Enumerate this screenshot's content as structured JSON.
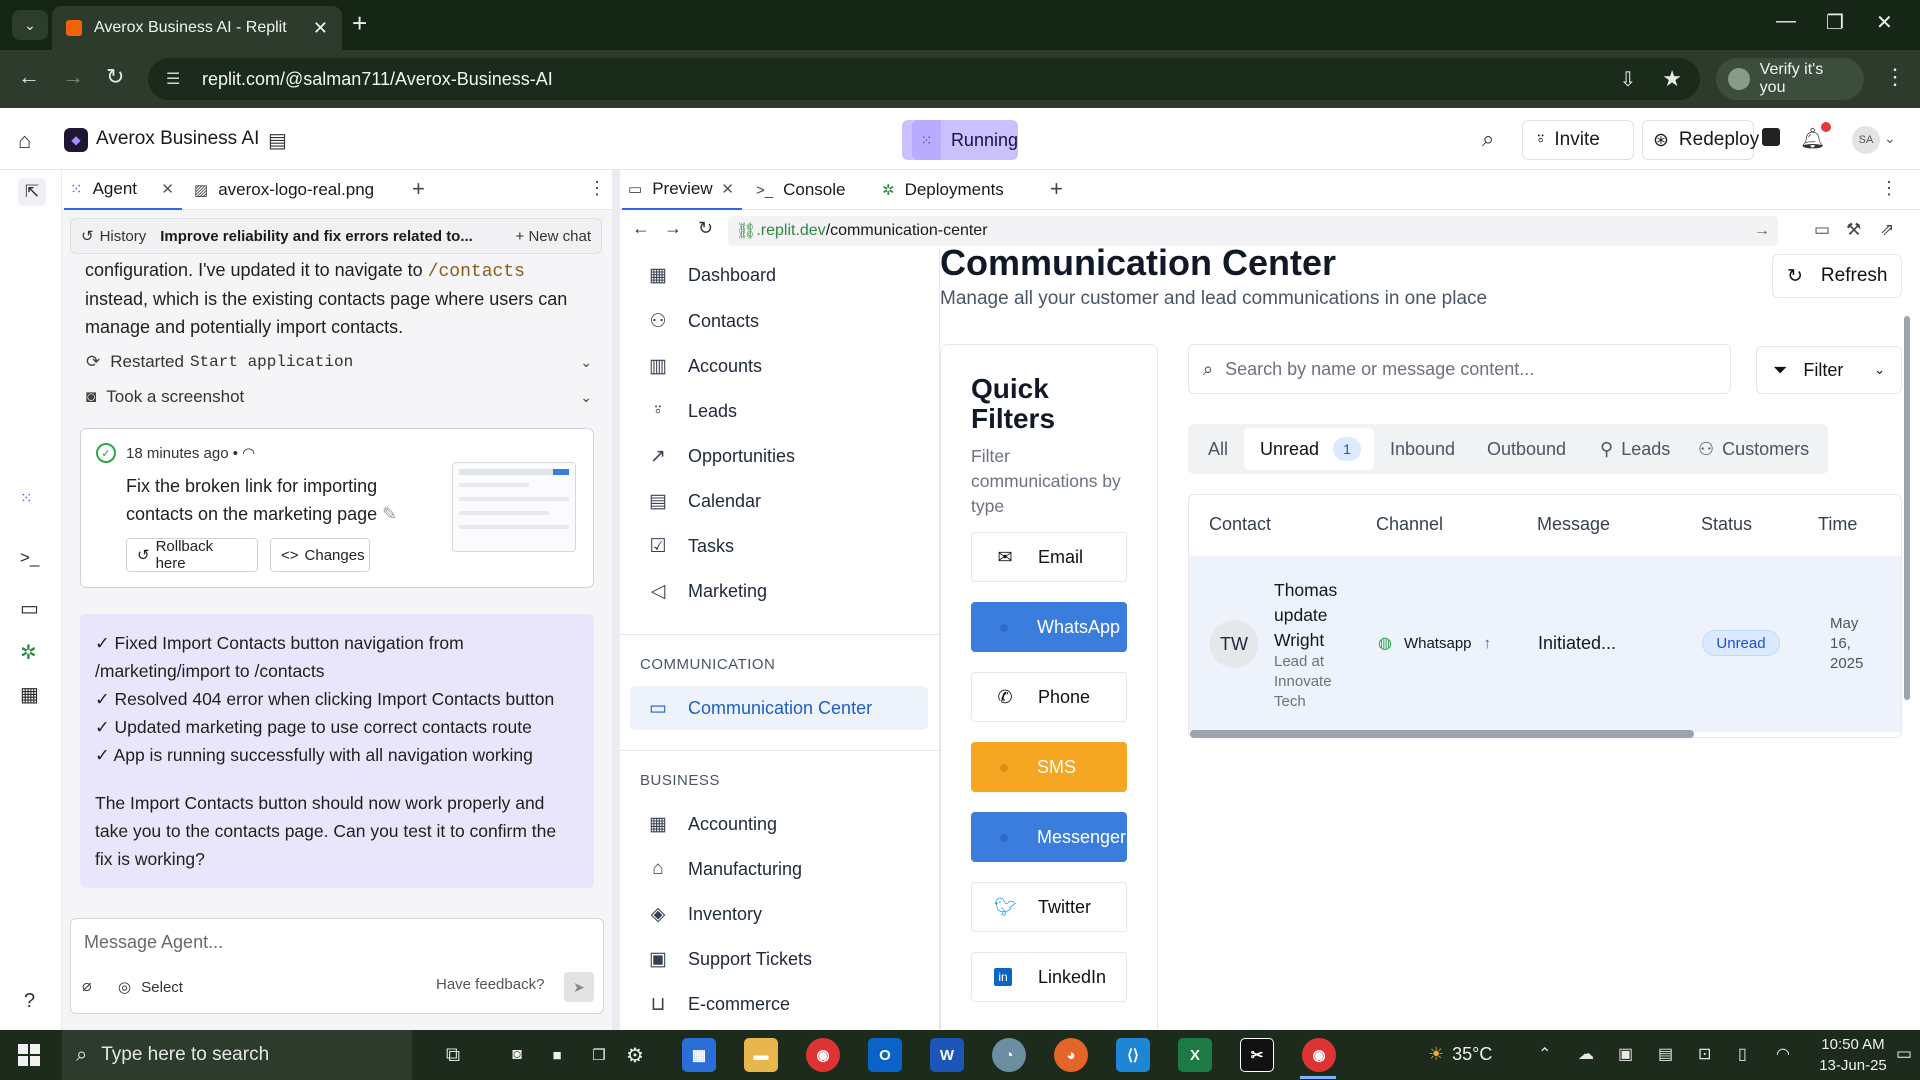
{
  "browser": {
    "tab_title": "Averox Business AI - Replit",
    "url": "replit.com/@salman711/Averox-Business-AI",
    "verify_label": "Verify it's you"
  },
  "header": {
    "app_name": "Averox Business AI",
    "status": "Running",
    "invite_label": "Invite",
    "redeploy_label": "Redeploy",
    "avatar_initials": "SA"
  },
  "agent_panel": {
    "tabs": [
      {
        "label": "Agent"
      },
      {
        "label": "averox-logo-real.png"
      }
    ],
    "history_label": "History",
    "thread_title": "Improve reliability and fix errors related to...",
    "new_chat_label": "New chat",
    "prev_text_1": "configuration. I've updated it to navigate to",
    "prev_code": "/contacts",
    "prev_text_2": "instead, which is the existing contacts page where users can",
    "prev_text_3": "manage and potentially import contacts.",
    "action_restart_label": "Restarted",
    "action_restart_code": "Start application",
    "action_screenshot": "Took a screenshot",
    "checkpoint": {
      "time": "18 minutes ago",
      "title": "Fix the broken link for importing contacts on the marketing page",
      "rollback_label": "Rollback here",
      "changes_label": "Changes"
    },
    "summary_lines": [
      "✓ Fixed Import Contacts button navigation from",
      "/marketing/import to /contacts",
      "✓ Resolved 404 error when clicking Import Contacts button",
      "✓ Updated marketing page to use correct contacts route",
      "✓ App is running successfully with all navigation working"
    ],
    "closing_lines": [
      "The Import Contacts button should now work properly and",
      "take you to the contacts page. Can you test it to confirm the",
      "fix is working?"
    ],
    "input_placeholder": "Message Agent...",
    "select_label": "Select",
    "feedback_label": "Have feedback?"
  },
  "preview_panel": {
    "tabs": [
      {
        "label": "Preview"
      },
      {
        "label": "Console"
      },
      {
        "label": "Deployments"
      }
    ],
    "url_domain": ".replit.dev",
    "url_path": "/communication-center"
  },
  "app_nav": {
    "items": [
      {
        "label": "Dashboard",
        "icon": "grid-icon"
      },
      {
        "label": "Contacts",
        "icon": "users-icon"
      },
      {
        "label": "Accounts",
        "icon": "building-icon"
      },
      {
        "label": "Leads",
        "icon": "user-plus-icon"
      },
      {
        "label": "Opportunities",
        "icon": "trending-icon"
      },
      {
        "label": "Calendar",
        "icon": "calendar-icon"
      },
      {
        "label": "Tasks",
        "icon": "check-square-icon"
      },
      {
        "label": "Marketing",
        "icon": "megaphone-icon"
      }
    ],
    "section_communication": "COMMUNICATION",
    "communication_item": "Communication Center",
    "section_business": "BUSINESS",
    "business_items": [
      {
        "label": "Accounting",
        "icon": "calculator-icon"
      },
      {
        "label": "Manufacturing",
        "icon": "factory-icon"
      },
      {
        "label": "Inventory",
        "icon": "box-icon"
      },
      {
        "label": "Support Tickets",
        "icon": "ticket-icon"
      },
      {
        "label": "E-commerce",
        "icon": "cart-icon"
      }
    ]
  },
  "main": {
    "title": "Communication Center",
    "subtitle": "Manage all your customer and lead communications in one place",
    "refresh_label": "Refresh",
    "quick_filters_title": "Quick Filters",
    "quick_filters_sub": "Filter communications by type",
    "quick_filters": [
      {
        "label": "Email",
        "color": "#ffffff"
      },
      {
        "label": "WhatsApp",
        "color": "#3b7ddd"
      },
      {
        "label": "Phone",
        "color": "#ffffff"
      },
      {
        "label": "SMS",
        "color": "#f5a623"
      },
      {
        "label": "Messenger",
        "color": "#3b7ddd"
      },
      {
        "label": "Twitter",
        "color": "#ffffff"
      },
      {
        "label": "LinkedIn",
        "color": "#ffffff"
      }
    ],
    "search_placeholder": "Search by name or message content...",
    "filter_label": "Filter",
    "tabs": [
      {
        "label": "All"
      },
      {
        "label": "Unread",
        "count": "1"
      },
      {
        "label": "Inbound"
      },
      {
        "label": "Outbound"
      },
      {
        "label": "Leads"
      },
      {
        "label": "Customers"
      }
    ],
    "table": {
      "headers": [
        "Contact",
        "Channel",
        "Message",
        "Status",
        "Time"
      ],
      "rows": [
        {
          "initials": "TW",
          "name": "Thomas update Wright",
          "subtitle": "Lead at Innovate Tech",
          "channel": "Whatsapp",
          "message": "Initiated...",
          "status": "Unread",
          "time": "May 16, 2025"
        }
      ]
    }
  },
  "taskbar": {
    "search_placeholder": "Type here to search",
    "temperature": "35°C",
    "time": "10:50 AM",
    "date": "13-Jun-25"
  }
}
